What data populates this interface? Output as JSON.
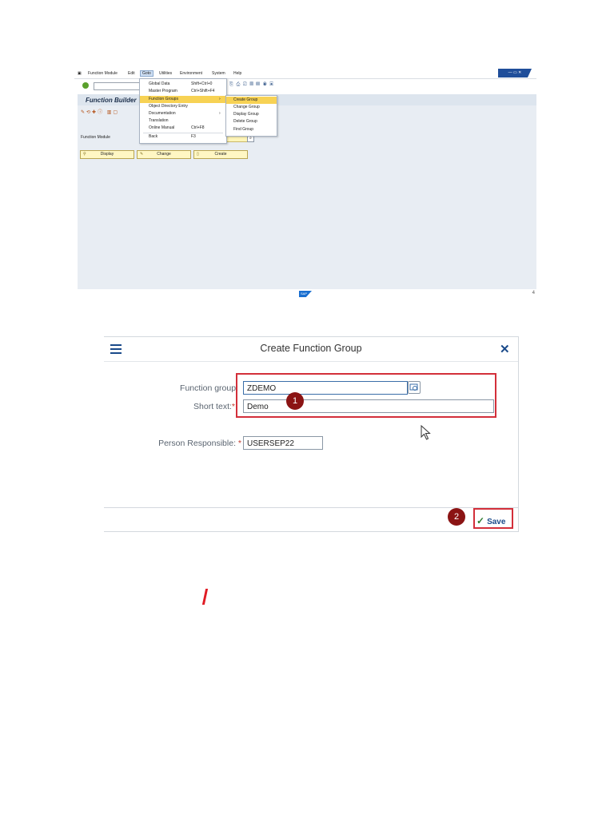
{
  "sap_gui": {
    "menubar": [
      "Function Module",
      "Edit",
      "Goto",
      "Utilities",
      "Environment",
      "System",
      "Help"
    ],
    "active_menu": "Goto",
    "app_title": "Function Builder",
    "function_module_label": "Function Module",
    "buttons": {
      "display": "Display",
      "change": "Change",
      "create": "Create"
    },
    "page_number": "4",
    "logo_text": "SAP",
    "goto_menu": [
      {
        "label": "Global Data",
        "shortcut": "Shift+Ctrl+0",
        "submenu": false
      },
      {
        "label": "Master Program",
        "shortcut": "Ctrl+Shift+F4",
        "submenu": false
      },
      {
        "label": "Function Groups",
        "shortcut": "",
        "submenu": true,
        "highlighted": true
      },
      {
        "label": "Object Directory Entry",
        "shortcut": "",
        "submenu": false
      },
      {
        "label": "Documentation",
        "shortcut": "",
        "submenu": true
      },
      {
        "label": "Translation",
        "shortcut": "",
        "submenu": false
      },
      {
        "label": "Online Manual",
        "shortcut": "Ctrl+F8",
        "submenu": false
      },
      {
        "label": "Back",
        "shortcut": "F3",
        "submenu": false
      }
    ],
    "function_groups_submenu": [
      {
        "label": "Create Group",
        "highlighted": true
      },
      {
        "label": "Change Group"
      },
      {
        "label": "Display Group"
      },
      {
        "label": "Delete Group"
      },
      {
        "label": "Find Group"
      }
    ]
  },
  "dialog": {
    "title": "Create Function Group",
    "function_group_label": "Function group:",
    "function_group_value": "ZDEMO",
    "short_text_label": "Short text:",
    "short_text_value": "Demo",
    "person_responsible_label": "Person Responsible:",
    "person_responsible_value": "USERSEP22",
    "required_marker": "*",
    "save_label": "Save",
    "step_badges": [
      "1",
      "2"
    ]
  },
  "colors": {
    "sap_body": "#e8edf3",
    "highlight": "#f7d254",
    "annotation_red": "#d32f3a",
    "badge": "#8b1414",
    "fiori_blue": "#1a4a8a"
  }
}
